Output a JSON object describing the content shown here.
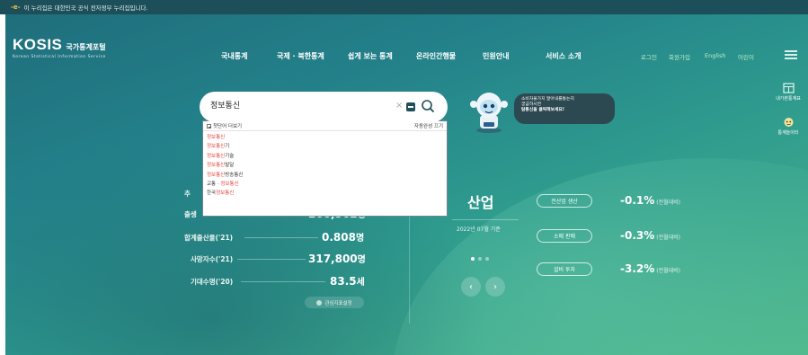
{
  "notice": {
    "gov_mark": "-e-",
    "text": "이 누리집은 대한민국 공식 전자정부 누리집입니다."
  },
  "header": {
    "logo_main": "KOSIS",
    "logo_kr": "국가통계포털",
    "logo_sub": "Korean Statistical Information Service",
    "nav": [
      "국내통계",
      "국제 · 북한통계",
      "쉽게 보는 통계",
      "온라인간행물",
      "민원안내",
      "서비스 소개"
    ],
    "util": [
      "로그인",
      "회원가입",
      "English",
      "어린이"
    ]
  },
  "side_tools": [
    {
      "label": "내가본통계표",
      "icon": "table-icon"
    },
    {
      "label": "통계놀이터",
      "icon": "character-icon"
    }
  ],
  "search": {
    "value": "정보통신",
    "autocomplete": {
      "header_left": "첫단어 더보기",
      "header_right": "자동완성 끄기",
      "items": [
        {
          "pre": "",
          "hl": "정보통신",
          "post": ""
        },
        {
          "pre": "",
          "hl": "정보통신",
          "post": "기"
        },
        {
          "pre": "",
          "hl": "정보통신",
          "post": "기술"
        },
        {
          "pre": "",
          "hl": "정보통신",
          "post": "발달"
        },
        {
          "pre": "",
          "hl": "정보통신",
          "post": "방송통신"
        },
        {
          "pre": "교통 · ",
          "hl": "정보통신",
          "post": ""
        },
        {
          "pre": "한국",
          "hl": "정보통신",
          "post": ""
        }
      ]
    }
  },
  "mascot_bubble": {
    "line1": "소비자물가지 알아내를통는지",
    "line2": "궁금하시면",
    "line3": "탐통신을 클릭해보세요!"
  },
  "stats": [
    {
      "label": "추",
      "value": ""
    },
    {
      "label": "출생",
      "value": "260,562",
      "unit": "명"
    },
    {
      "label": "합계출산율('21)",
      "value": "0.808",
      "unit": "명"
    },
    {
      "label": "사망자수('21)",
      "value": "317,800",
      "unit": "명"
    },
    {
      "label": "기대수명('20)",
      "value": "83.5",
      "unit": "세"
    }
  ],
  "favorite_button": "관심지표설정",
  "industry": {
    "title": "산업",
    "ref_date": "2022년 07월 기준",
    "indicators": [
      {
        "name": "전산업 생산",
        "value": "-0.1%",
        "note": "(전월대비)"
      },
      {
        "name": "소매 판매",
        "value": "-0.3%",
        "note": "(전월대비)"
      },
      {
        "name": "설비 투자",
        "value": "-3.2%",
        "note": "(전월대비)"
      }
    ],
    "prev": "‹",
    "next": "›"
  },
  "colors": {
    "header_bar": "#1c4f5a",
    "hero_start": "#1f6e7c",
    "hero_end": "#4cb68a",
    "highlight": "#e0443b",
    "util_text": "#b9f0c8"
  }
}
